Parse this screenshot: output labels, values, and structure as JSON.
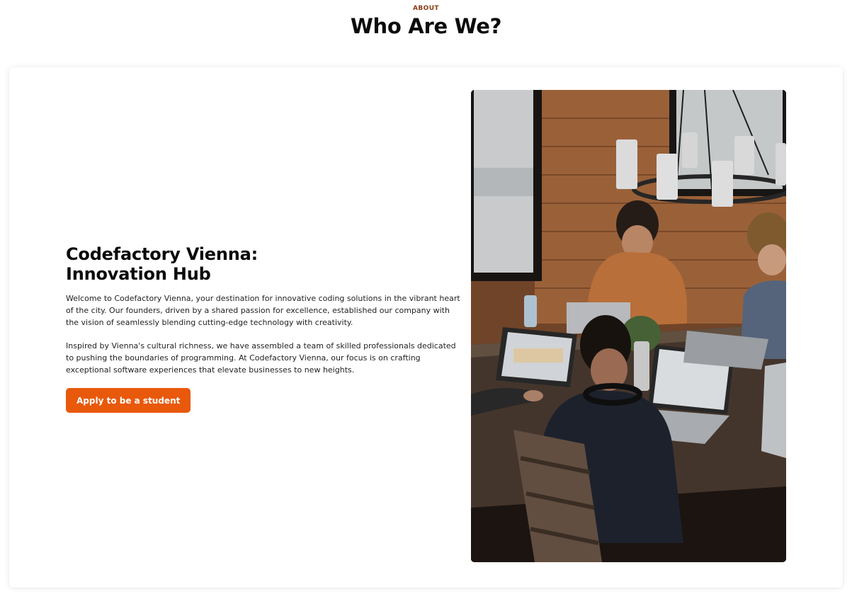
{
  "header": {
    "eyebrow": "ABOUT",
    "title": "Who Are We?"
  },
  "about": {
    "headline_line1": "Codefactory Vienna:",
    "headline_line2": "Innovation Hub",
    "paragraph1": "Welcome to Codefactory Vienna, your destination for innovative coding solutions in the vibrant heart of the city. Our founders, driven by a shared passion for excellence, established our company with the vision of seamlessly blending cutting-edge technology with creativity.",
    "paragraph2": "Inspired by Vienna's cultural richness, we have assembled a team of skilled professionals dedicated to pushing the boundaries of programming. At Codefactory Vienna, our focus is on crafting exceptional software experiences that elevate businesses to new heights.",
    "apply_label": "Apply to be a student"
  },
  "photo": {
    "icon": "team-photo-image"
  },
  "colors": {
    "accent": "#e8590c",
    "eyebrow": "#8a3a12",
    "text": "#111111"
  }
}
